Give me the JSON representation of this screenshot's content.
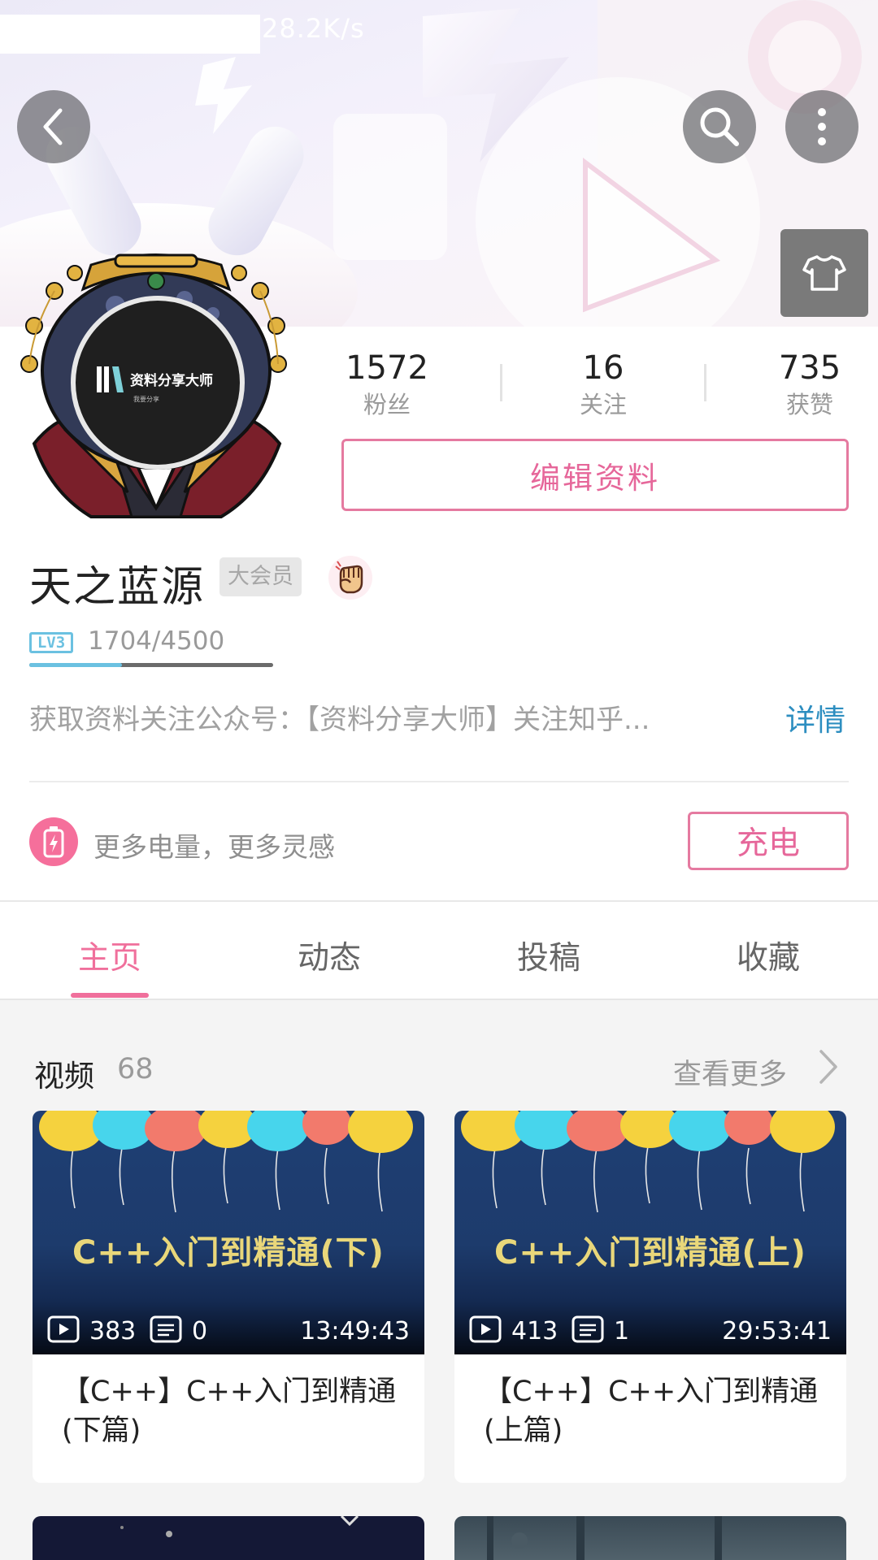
{
  "status": {
    "net_speed": "28.2K/s"
  },
  "header": {
    "back_label": "back",
    "search_label": "search",
    "more_label": "more"
  },
  "profile": {
    "stats": [
      {
        "value": "1572",
        "label": "粉丝"
      },
      {
        "value": "16",
        "label": "关注"
      },
      {
        "value": "735",
        "label": "获赞"
      }
    ],
    "edit_label": "编辑资料",
    "avatar_logo_text": "资料分享大师",
    "avatar_logo_sub": "我要分享",
    "name": "天之蓝源",
    "vip_label": "大会员",
    "level": {
      "tag": "LV3",
      "progress_text": "1704/4500",
      "progress_fraction": 0.379
    },
    "sign": "获取资料关注公众号：【资料分享大师】关注知乎...",
    "detail_label": "详情"
  },
  "charge": {
    "text": "更多电量，更多灵感",
    "button": "充电"
  },
  "tabs": [
    {
      "label": "主页",
      "active": true
    },
    {
      "label": "动态",
      "active": false
    },
    {
      "label": "投稿",
      "active": false
    },
    {
      "label": "收藏",
      "active": false
    }
  ],
  "videos": {
    "title": "视频",
    "count": "68",
    "more_label": "查看更多",
    "items": [
      {
        "thumb_text": "C++入门到精通(下)",
        "plays": "383",
        "comments": "0",
        "duration": "13:49:43",
        "title": "【C++】C++入门到精通(下篇)"
      },
      {
        "thumb_text": "C++入门到精通(上)",
        "plays": "413",
        "comments": "1",
        "duration": "29:53:41",
        "title": "【C++】C++入门到精通(上篇)"
      }
    ]
  },
  "colors": {
    "accent_pink": "#f0709c",
    "link_blue": "#2d8ec0",
    "level_blue": "#6bc1e1"
  }
}
